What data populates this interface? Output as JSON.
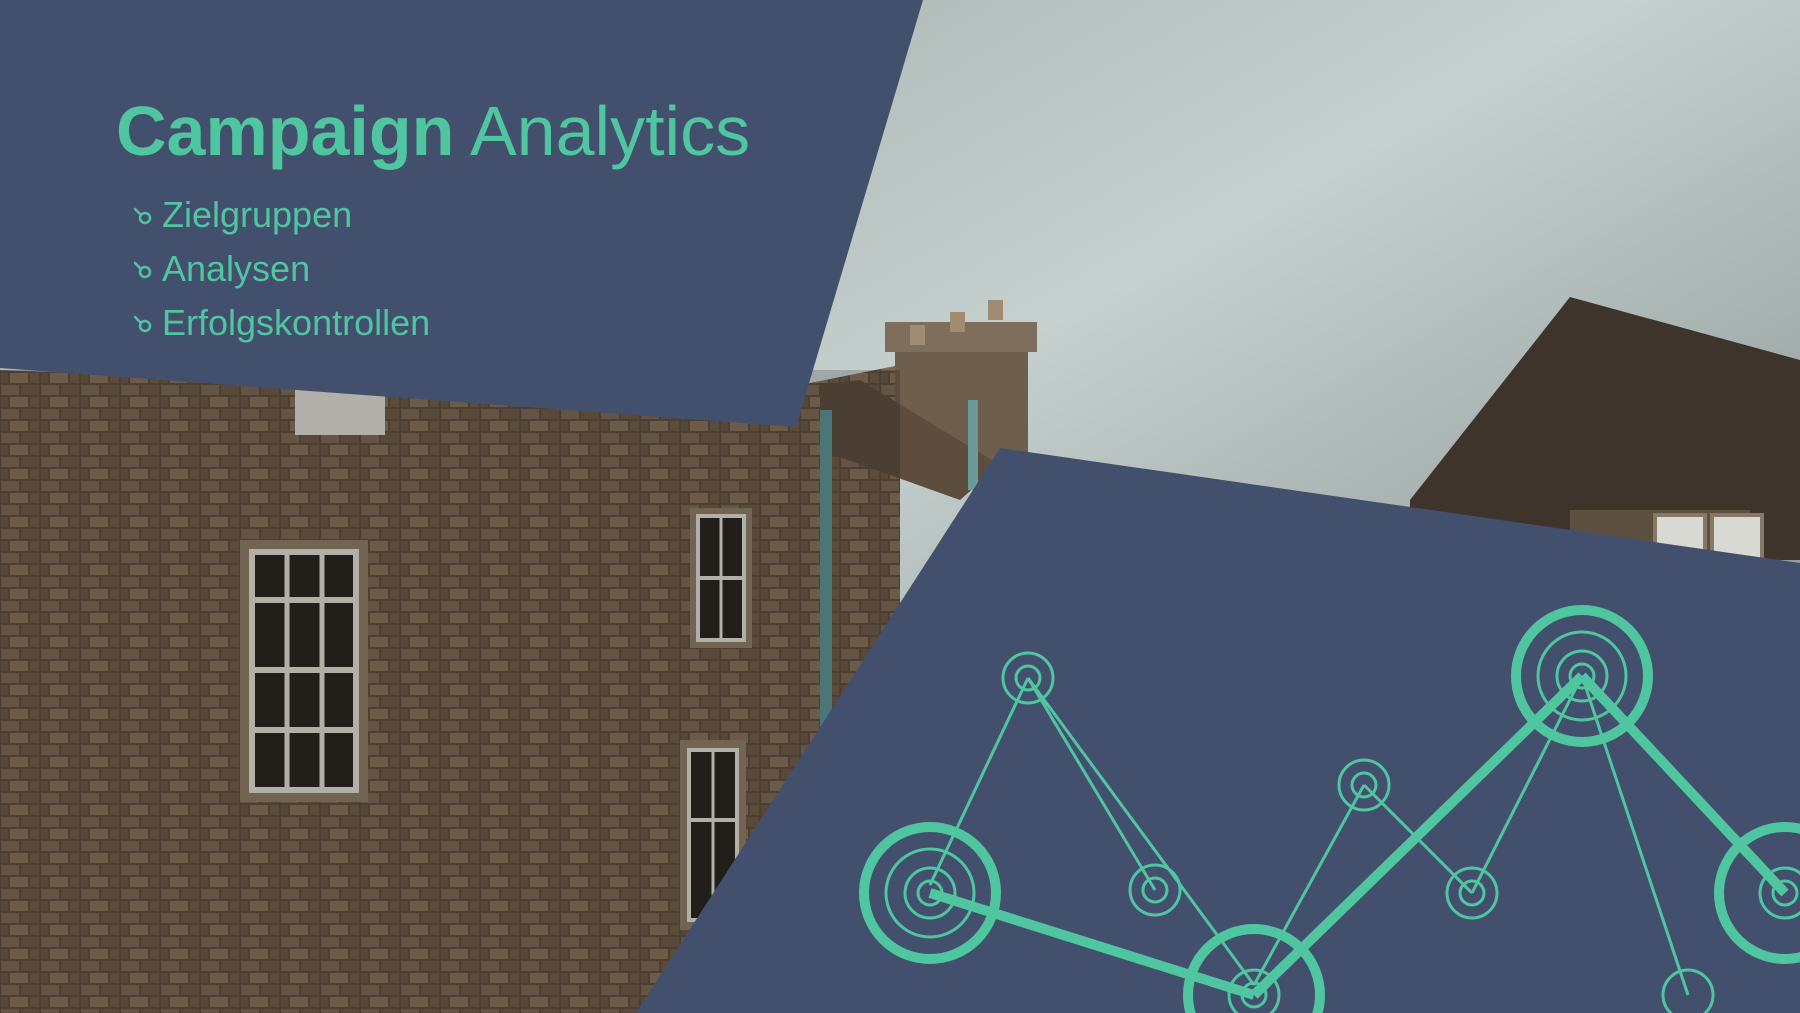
{
  "slide": {
    "title_strong": "Campaign",
    "title_light": "Analytics",
    "bullets": [
      {
        "label": "Zielgruppen",
        "icon": "hook-arrow-icon"
      },
      {
        "label": "Analysen",
        "icon": "hook-arrow-icon"
      },
      {
        "label": "Erfolgskontrollen",
        "icon": "hook-arrow-icon"
      }
    ],
    "colors": {
      "accent": "#4fc5a0",
      "panel": "#43506d",
      "sky_light": "#c9d3d2",
      "sky_dark": "#77817f",
      "stone": "#6b5947"
    },
    "illustration": "network-line-graph-icon"
  }
}
